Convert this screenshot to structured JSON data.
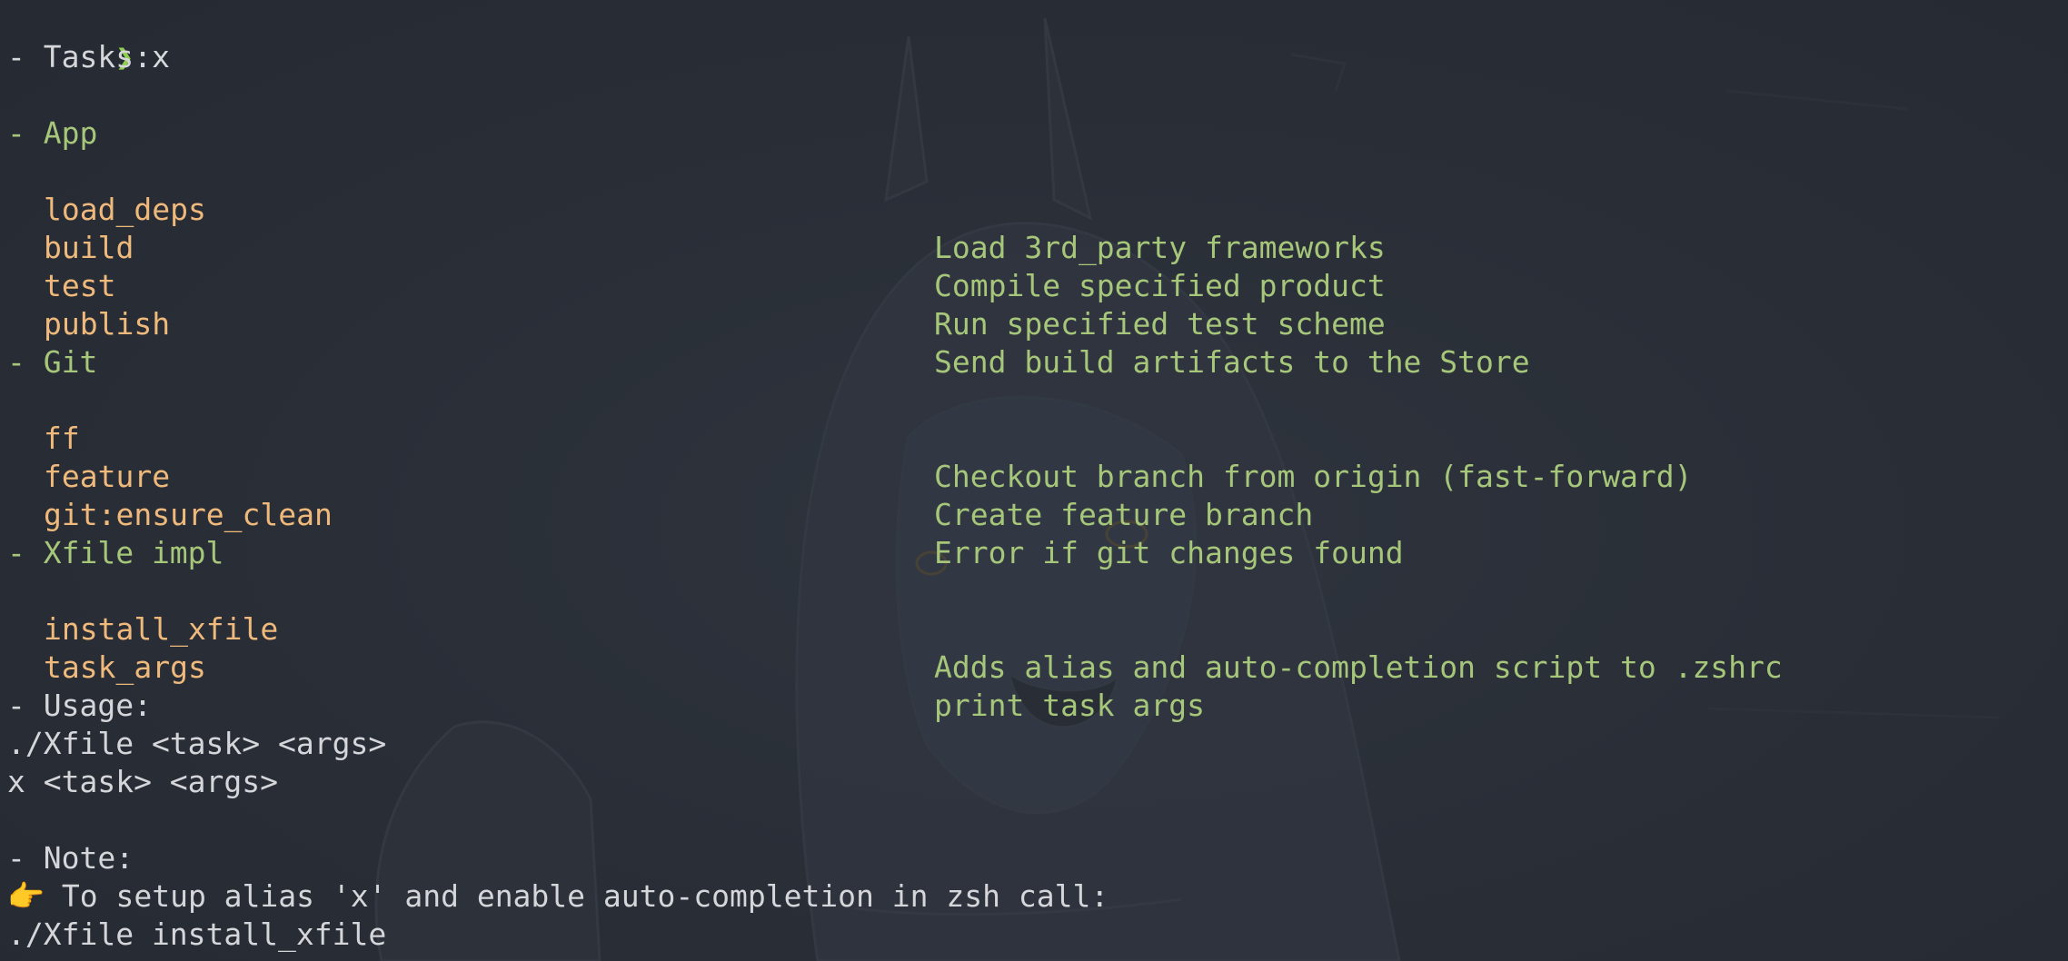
{
  "prompt": {
    "symbol": "❯",
    "command": "x"
  },
  "tasks_header": "- Tasks:",
  "groups": [
    {
      "title": "- App",
      "tasks": [
        {
          "name": "load_deps",
          "desc": "Load 3rd_party frameworks"
        },
        {
          "name": "build",
          "desc": "Compile specified product"
        },
        {
          "name": "test",
          "desc": "Run specified test scheme"
        },
        {
          "name": "publish",
          "desc": "Send build artifacts to the Store"
        }
      ]
    },
    {
      "title": "- Git",
      "tasks": [
        {
          "name": "ff",
          "desc": "Checkout branch from origin (fast-forward)"
        },
        {
          "name": "feature",
          "desc": "Create feature branch"
        },
        {
          "name": "git:ensure_clean",
          "desc": "Error if git changes found"
        }
      ]
    },
    {
      "title": "- Xfile impl",
      "tasks": [
        {
          "name": "install_xfile",
          "desc": "Adds alias and auto-completion script to .zshrc"
        },
        {
          "name": "task_args",
          "desc": "print task args"
        }
      ]
    }
  ],
  "usage": {
    "header": "- Usage:",
    "lines": [
      "./Xfile <task> <args>",
      "x <task> <args>"
    ]
  },
  "note": {
    "header": "- Note:",
    "emoji": "👉",
    "text": " To setup alias 'x' and enable auto-completion in zsh call:",
    "command": "./Xfile install_xfile"
  },
  "colors": {
    "background": "#272c35",
    "prompt_arrow": "#8fd14f",
    "task_name": "#f0b97c",
    "group_title": "#a6c67a",
    "description": "#a6c67a",
    "plain_text": "#d4d6da"
  }
}
